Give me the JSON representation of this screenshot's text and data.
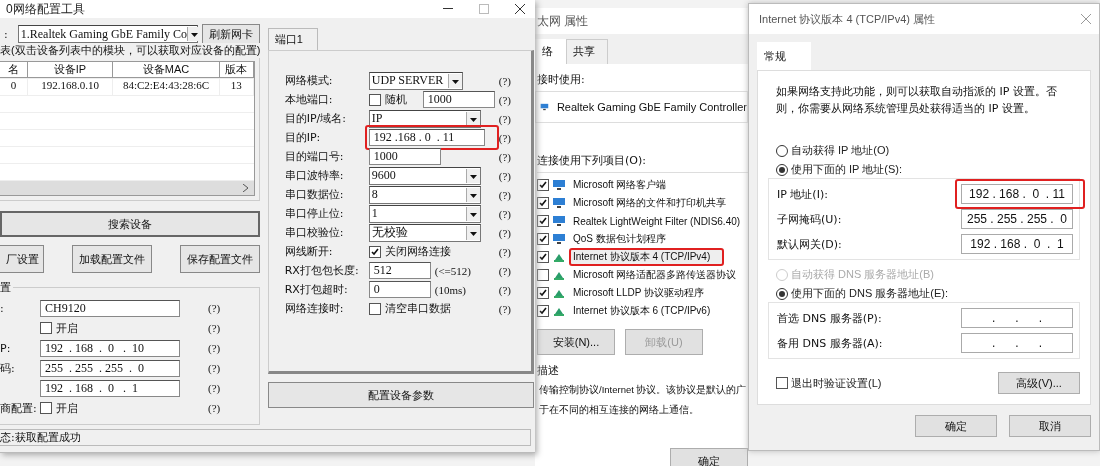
{
  "config_tool": {
    "title": "0网络配置工具",
    "adapter_label": ":",
    "adapter": "1.Realtek Gaming GbE Family Co",
    "refresh_button": "刷新网卡",
    "device_list": {
      "title": "表(双击设备列表中的模块，可以获取对应设备的配置)",
      "columns": [
        "名",
        "设备IP",
        "设备MAC",
        "版本"
      ],
      "rows": [
        {
          "cells": [
            "0",
            "192.168.0.10",
            "84:C2:E4:43:28:6C",
            "13"
          ]
        }
      ]
    },
    "search_button": "搜索设备",
    "buttons": [
      "厂设置",
      "加载配置文件",
      "保存配置文件"
    ],
    "config_group": {
      "title": "置",
      "rows": [
        {
          "kind": "text",
          "label": ":",
          "value": "CH9120",
          "help": "(?)"
        },
        {
          "kind": "checkbox",
          "text": "开启",
          "checked": false,
          "help": "(?)"
        },
        {
          "kind": "ip",
          "label": "P:",
          "value": "192  . 168  .  0   .  10",
          "help": "(?)"
        },
        {
          "kind": "ip",
          "label": "码:",
          "value": "255  . 255  . 255  .  0",
          "help": "(?)"
        },
        {
          "kind": "ip",
          "value": "192  . 168  .  0   .  1",
          "help": "(?)"
        },
        {
          "kind": "checkbox",
          "label": "商配置:",
          "text": "开启",
          "checked": false,
          "help": "(?)"
        }
      ]
    },
    "status": "态:获取配置成功",
    "port_tab": "端口1",
    "port_rows": [
      {
        "kind": "select",
        "label": "网络模式:",
        "value": "UDP SERVER",
        "help": "(?)",
        "highlighted": false
      },
      {
        "kind": "check_input",
        "label": "本地端口:",
        "text": "随机",
        "checked": false,
        "value": "1000",
        "help": "(?)",
        "highlighted": false
      },
      {
        "kind": "select",
        "label": "目的IP/域名:",
        "value": "IP",
        "help": "(?)",
        "highlighted": false
      },
      {
        "kind": "ip",
        "label": "目的IP:",
        "value": "192 .168 . 0  . 11",
        "help": "(?)",
        "highlighted": true
      },
      {
        "kind": "text",
        "label": "目的端口号:",
        "value": "1000",
        "help": "(?)",
        "highlighted": false
      },
      {
        "kind": "select",
        "label": "串口波特率:",
        "value": "9600",
        "help": "(?)",
        "highlighted": false
      },
      {
        "kind": "select",
        "label": "串口数据位:",
        "value": "8",
        "help": "(?)",
        "highlighted": false
      },
      {
        "kind": "select",
        "label": "串口停止位:",
        "value": "1",
        "help": "(?)",
        "highlighted": false
      },
      {
        "kind": "select",
        "label": "串口校验位:",
        "value": "无校验",
        "help": "(?)",
        "highlighted": false
      },
      {
        "kind": "checkbox",
        "label": "网线断开:",
        "text": "关闭网络连接",
        "checked": true,
        "help": "(?)",
        "highlighted": false
      },
      {
        "kind": "input_unit",
        "label": "RX打包包长度:",
        "value": "512",
        "unit": "(<=512)",
        "help": "(?)",
        "highlighted": false
      },
      {
        "kind": "input_unit",
        "label": "RX打包超时:",
        "value": "0",
        "unit": "(10ms)",
        "help": "(?)",
        "highlighted": false
      },
      {
        "kind": "checkbox",
        "label": "网络连接时:",
        "text": "清空串口数据",
        "checked": false,
        "help": "(?)",
        "highlighted": false
      }
    ],
    "configure_button": "配置设备参数"
  },
  "ethernet_props": {
    "title": "太网 属性",
    "tabs": [
      {
        "label": "络",
        "selected": true
      },
      {
        "label": "共享",
        "selected": false
      }
    ],
    "connect_using_label": "接时使用:",
    "adapter": "Realtek Gaming GbE Family Controller",
    "items_label": "连接使用下列项目(O):",
    "items": [
      {
        "label": "Microsoft 网络客户端",
        "checked": true,
        "kind": "network",
        "highlighted": false
      },
      {
        "label": "Microsoft 网络的文件和打印机共享",
        "checked": true,
        "kind": "network",
        "highlighted": false
      },
      {
        "label": "Realtek LightWeight Filter (NDIS6.40)",
        "checked": true,
        "kind": "network",
        "highlighted": false
      },
      {
        "label": "QoS 数据包计划程序",
        "checked": true,
        "kind": "network",
        "highlighted": false
      },
      {
        "label": "Internet 协议版本 4 (TCP/IPv4)",
        "checked": true,
        "kind": "protocol",
        "highlighted": true
      },
      {
        "label": "Microsoft 网络适配器多路传送器协议",
        "checked": false,
        "kind": "protocol",
        "highlighted": false
      },
      {
        "label": "Microsoft LLDP 协议驱动程序",
        "checked": true,
        "kind": "protocol",
        "highlighted": false
      },
      {
        "label": "Internet 协议版本 6 (TCP/IPv6)",
        "checked": true,
        "kind": "protocol",
        "highlighted": false
      }
    ],
    "buttons": [
      {
        "label": "安装(N)...",
        "disabled": false
      },
      {
        "label": "卸载(U)",
        "disabled": true
      }
    ],
    "description_title": "描述",
    "description": [
      "传输控制协议/Internet 协议。该协议是默认的广",
      "于在不同的相互连接的网络上通信。"
    ],
    "ok_button": "确定"
  },
  "ipv4_props": {
    "title": "Internet 协议版本 4 (TCP/IPv4) 属性",
    "tabs": [
      {
        "label": "常规",
        "selected": true
      }
    ],
    "intro": "如果网络支持此功能，则可以获取自动指派的 IP 设置。否则，你需要从网络系统管理员处获得适当的 IP 设置。",
    "ip_options": [
      {
        "label": "自动获得 IP 地址(O)",
        "selected": false,
        "disabled": false
      },
      {
        "label": "使用下面的 IP 地址(S):",
        "selected": true,
        "disabled": false
      }
    ],
    "ip_fields": [
      {
        "label": "IP 地址(I):",
        "value": "192 . 168 .  0  . 11",
        "highlighted": true
      },
      {
        "label": "子网掩码(U):",
        "value": "255 . 255 . 255 .  0",
        "highlighted": false
      },
      {
        "label": "默认网关(D):",
        "value": "192 . 168 .  0  .  1",
        "highlighted": false
      }
    ],
    "dns_options": [
      {
        "label": "自动获得 DNS 服务器地址(B)",
        "selected": false,
        "disabled": true
      },
      {
        "label": "使用下面的 DNS 服务器地址(E):",
        "selected": true,
        "disabled": false
      }
    ],
    "dns_fields": [
      {
        "label": "首选 DNS 服务器(P):",
        "value": ".      .      .",
        "highlighted": false
      },
      {
        "label": "备用 DNS 服务器(A):",
        "value": ".      .      .",
        "highlighted": false
      }
    ],
    "validate": {
      "label": "退出时验证设置(L)",
      "checked": false
    },
    "advanced_button": "高级(V)...",
    "buttons": [
      "确定",
      "取消"
    ]
  }
}
